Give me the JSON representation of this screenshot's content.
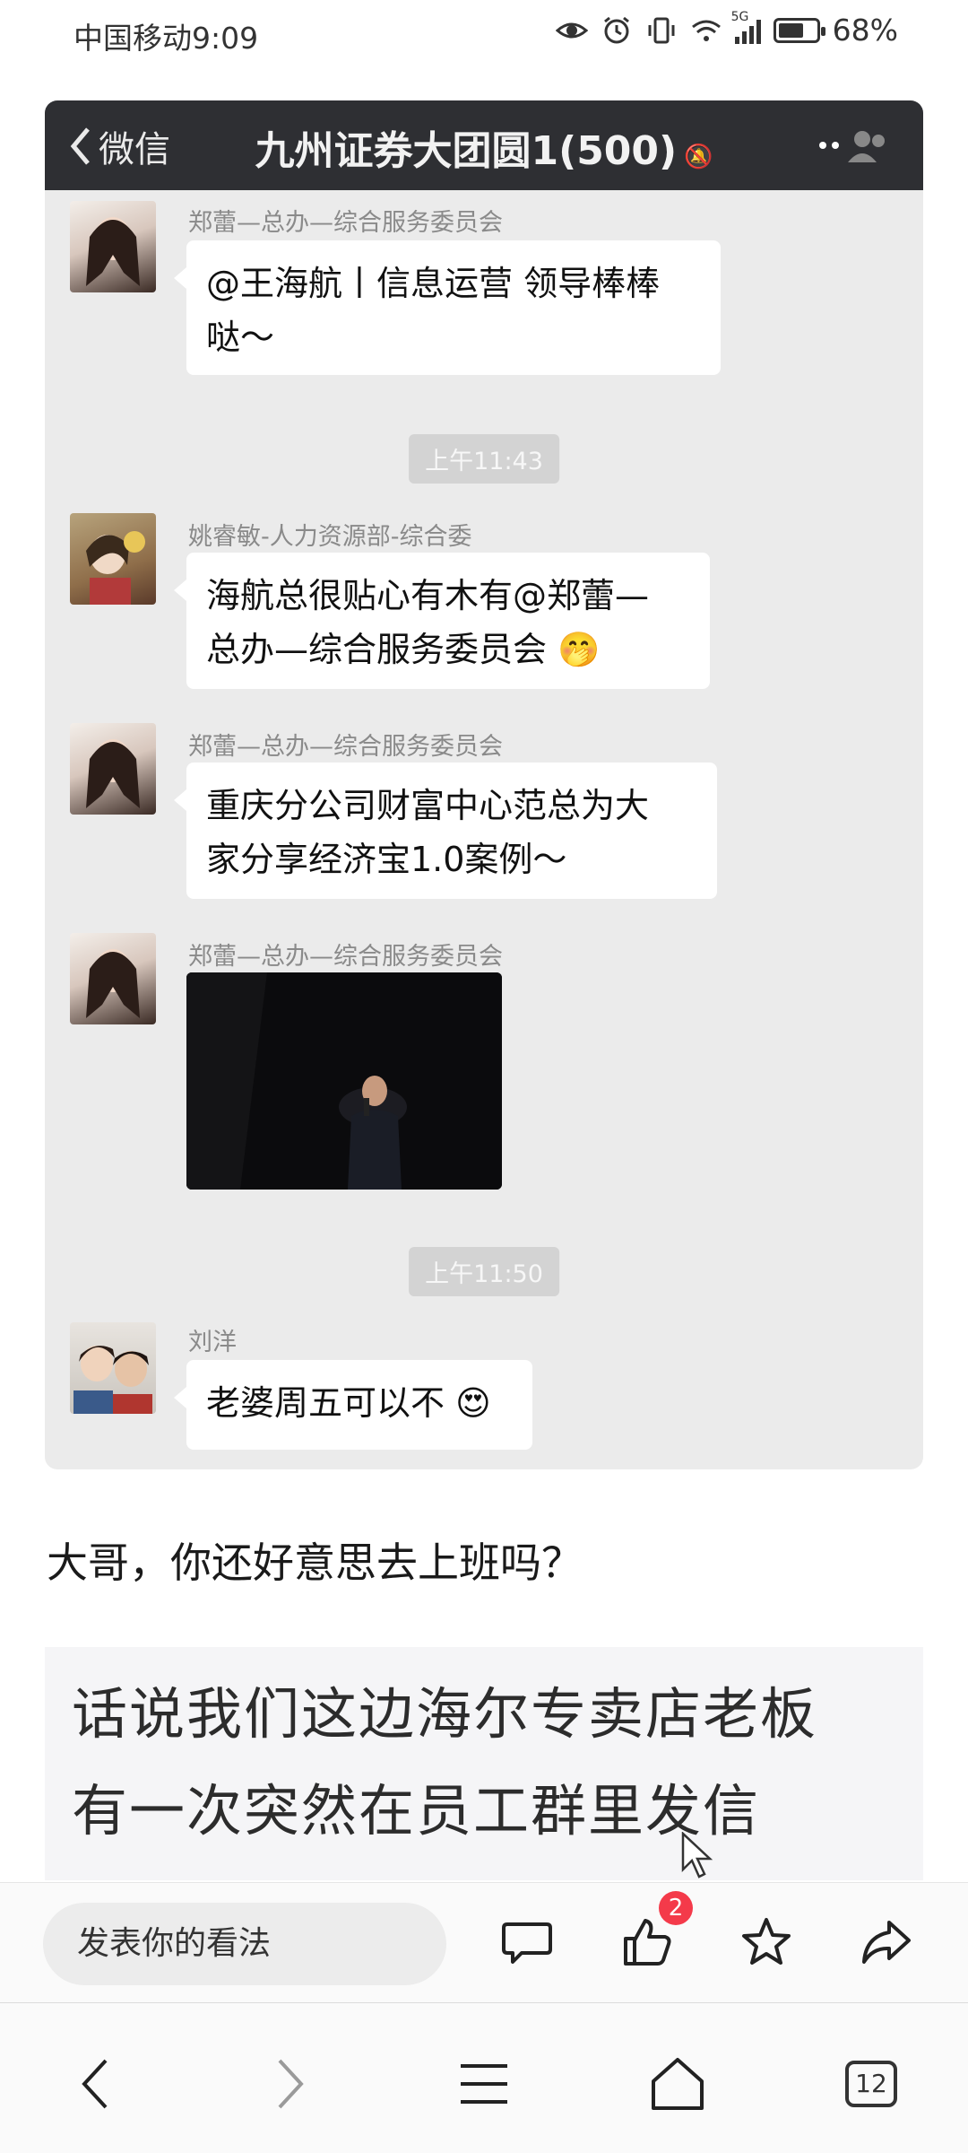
{
  "status_bar": {
    "carrier_time": "中国移动9:09",
    "signal_label": "5G",
    "battery_percent": "68%",
    "battery_level": 0.68
  },
  "chat": {
    "back_label": "微信",
    "title": "九州证券大团圆1(500)",
    "more_icon": "more-dots-icon",
    "messages": [
      {
        "sender": "郑蕾—总办—综合服务委员会",
        "text_line1": "@王海航丨信息运营 领导棒棒",
        "text_line2": "哒～"
      },
      {
        "time": "上午11:43"
      },
      {
        "sender": "姚睿敏-人力资源部-综合委",
        "text_line1": "海航总很贴心有木有@郑蕾—",
        "text_line2": "总办—综合服务委员会 🤭"
      },
      {
        "sender": "郑蕾—总办—综合服务委员会",
        "text_line1": "重庆分公司财富中心范总为大",
        "text_line2": "家分享经济宝1.0案例～"
      },
      {
        "sender": "郑蕾—总办—综合服务委员会",
        "image": "speaker-photo"
      },
      {
        "time": "上午11:50"
      },
      {
        "sender": "刘洋",
        "text_line1": "老婆周五可以不 😍"
      }
    ]
  },
  "article": {
    "caption": "大哥，你还好意思去上班吗？",
    "image2_line1": "话说我们这边海尔专卖店老板",
    "image2_line2": "有一次突然在员工群里发信"
  },
  "action_bar": {
    "comment_placeholder": "发表你的看法",
    "like_count": "2"
  },
  "nav_bar": {
    "tabs_count": "12"
  }
}
